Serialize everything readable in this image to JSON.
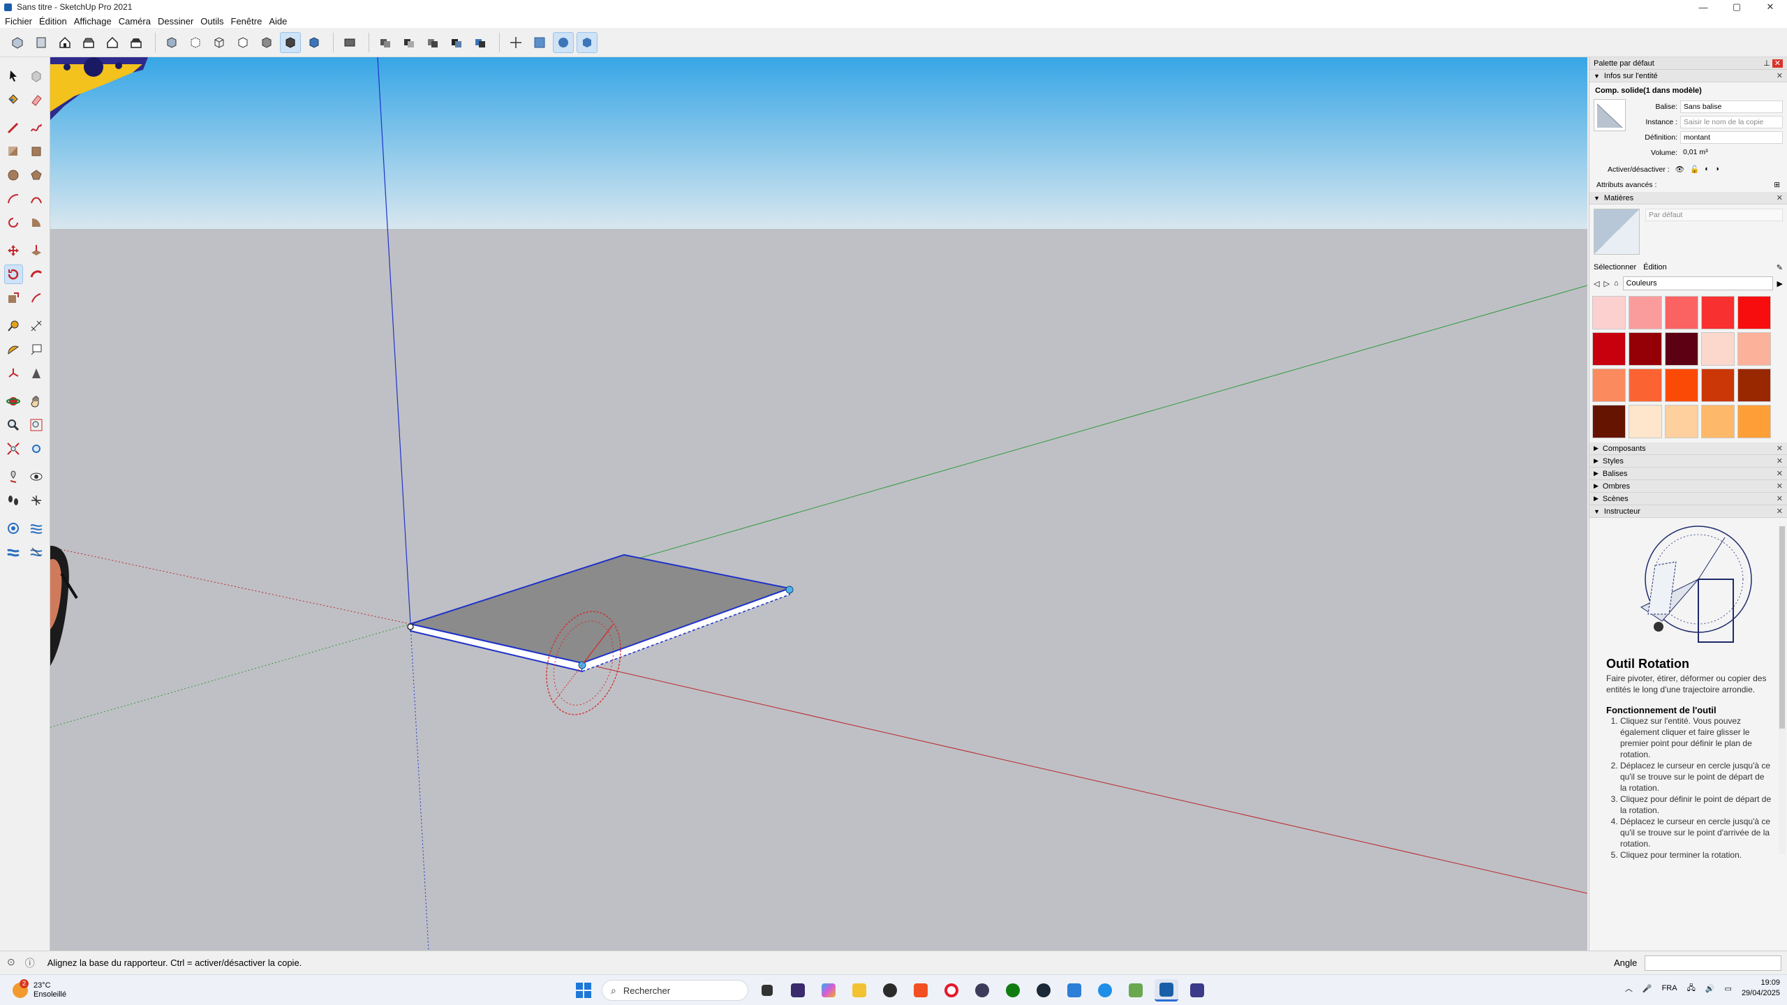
{
  "window": {
    "title": "Sans titre - SketchUp Pro 2021",
    "controls": [
      "—",
      "▢",
      "✕"
    ]
  },
  "menu": [
    "Fichier",
    "Édition",
    "Affichage",
    "Caméra",
    "Dessiner",
    "Outils",
    "Fenêtre",
    "Aide"
  ],
  "panel": {
    "title": "Palette par défaut",
    "entity_info": {
      "header": "Infos sur l'entité",
      "title": "Comp. solide(1 dans modèle)",
      "tag_label": "Balise:",
      "tag_value": "Sans balise",
      "instance_label": "Instance :",
      "instance_placeholder": "Saisir le nom de la copie",
      "definition_label": "Définition:",
      "definition_value": "montant",
      "volume_label": "Volume:",
      "volume_value": "0,01 m³",
      "toggle_label": "Activer/désactiver :",
      "advanced_label": "Attributs avancés :"
    },
    "materials": {
      "header": "Matières",
      "name": "Par défaut",
      "tab_select": "Sélectionner",
      "tab_edit": "Édition",
      "library": "Couleurs",
      "swatches": [
        "#fdd0d0",
        "#fb9c9c",
        "#fb6262",
        "#f93030",
        "#f70d0d",
        "#c8000e",
        "#950007",
        "#5d0014",
        "#fbd7cc",
        "#fbb19a",
        "#fb8a5e",
        "#fb6432",
        "#fb4a06",
        "#cc3708",
        "#992700",
        "#661402",
        "#fde6cc",
        "#fdd09e",
        "#fdb86a",
        "#fd9f36"
      ]
    },
    "collapsed_sections": [
      "Composants",
      "Styles",
      "Balises",
      "Ombres",
      "Scènes"
    ],
    "instructor": {
      "header": "Instructeur",
      "tool_title": "Outil Rotation",
      "tool_desc": "Faire pivoter, étirer, déformer ou copier des entités le long d'une trajectoire arrondie.",
      "how_title": "Fonctionnement de l'outil",
      "steps": [
        "Cliquez sur l'entité. Vous pouvez également cliquer et faire glisser le premier point pour définir le plan de rotation.",
        "Déplacez le curseur en cercle jusqu'à ce qu'il se trouve sur le point de départ de la rotation.",
        "Cliquez pour définir le point de départ de la rotation.",
        "Déplacez le curseur en cercle jusqu'à ce qu'il se trouve sur le point d'arrivée de la rotation.",
        "Cliquez pour terminer la rotation."
      ]
    }
  },
  "status": {
    "message": "Alignez la base du rapporteur.  Ctrl = activer/désactiver la copie.",
    "vcb_label": "Angle",
    "vcb_value": ""
  },
  "taskbar": {
    "temperature": "23°C",
    "weather": "Ensoleillé",
    "weather_badge": "2",
    "search_placeholder": "Rechercher",
    "language": "FRA",
    "time": "19:09",
    "date": "29/04/2025"
  }
}
